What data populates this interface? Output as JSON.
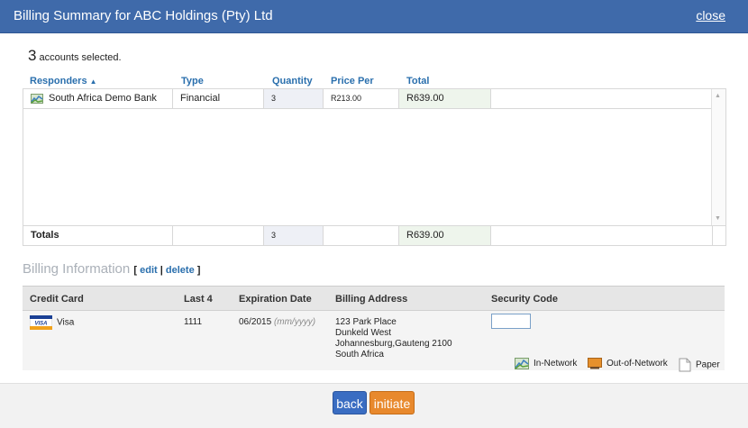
{
  "window": {
    "title": "Billing Summary for ABC Holdings (Pty) Ltd",
    "close_label": "close"
  },
  "selection": {
    "count": "3",
    "text": "accounts selected."
  },
  "responders": {
    "columns": {
      "responders": "Responders",
      "type": "Type",
      "quantity": "Quantity",
      "price_per": "Price Per",
      "total": "Total"
    },
    "rows": [
      {
        "name": "South Africa Demo Bank",
        "type": "Financial",
        "quantity": "3",
        "price_per": "R213.00",
        "total": "R639.00"
      }
    ],
    "totals": {
      "label": "Totals",
      "quantity": "3",
      "total": "R639.00"
    }
  },
  "billing": {
    "title": "Billing Information",
    "edit_label": "edit",
    "delete_label": "delete",
    "columns": {
      "credit_card": "Credit Card",
      "last4": "Last 4",
      "expiration": "Expiration Date",
      "address": "Billing Address",
      "security": "Security Code"
    },
    "card": {
      "brand": "Visa",
      "last4": "1111",
      "expiration": "06/2015",
      "expiration_hint": "(mm/yyyy)",
      "address_lines": [
        "123 Park Place",
        "Dunkeld West",
        "Johannesburg,Gauteng 2100",
        "South Africa"
      ],
      "security_code": ""
    }
  },
  "legend": {
    "in_network": "In-Network",
    "out_of_network": "Out-of-Network",
    "paper": "Paper"
  },
  "buttons": {
    "back": "back",
    "initiate": "initiate"
  }
}
